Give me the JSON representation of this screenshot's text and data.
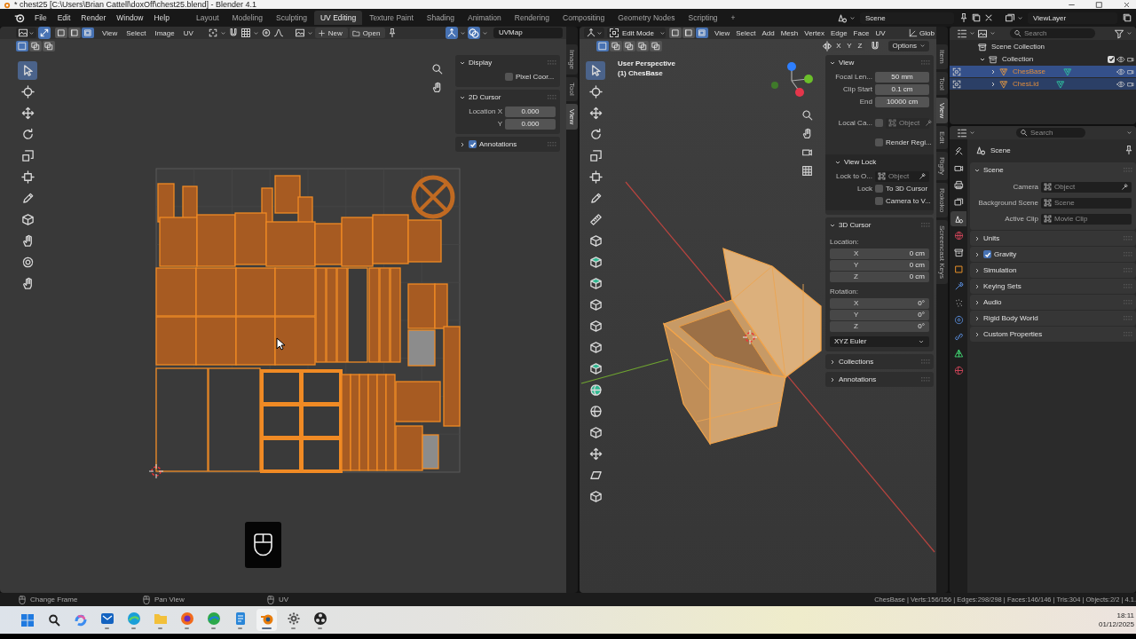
{
  "window": {
    "title": "* chest25 [C:\\Users\\Brian Cattell\\doxOff\\chest25.blend] - Blender 4.1"
  },
  "top_bar": {
    "menus": [
      "File",
      "Edit",
      "Render",
      "Window",
      "Help"
    ],
    "workspaces": [
      {
        "label": "Layout",
        "selected": false
      },
      {
        "label": "Modeling",
        "selected": false
      },
      {
        "label": "Sculpting",
        "selected": false
      },
      {
        "label": "UV Editing",
        "selected": true
      },
      {
        "label": "Texture Paint",
        "selected": false
      },
      {
        "label": "Shading",
        "selected": false
      },
      {
        "label": "Animation",
        "selected": false
      },
      {
        "label": "Rendering",
        "selected": false
      },
      {
        "label": "Compositing",
        "selected": false
      },
      {
        "label": "Geometry Nodes",
        "selected": false
      },
      {
        "label": "Scripting",
        "selected": false
      }
    ],
    "add_tab": "+",
    "scene": "Scene",
    "view_layer": "ViewLayer"
  },
  "uv_editor": {
    "header": {
      "uv_sync": true,
      "select_modes": [
        {
          "selected": false
        },
        {
          "selected": false
        },
        {
          "selected": true
        }
      ],
      "menus": [
        "View",
        "Select",
        "Image",
        "UV"
      ],
      "new_button": "New",
      "open_button": "Open",
      "toggles": [
        {
          "on": true
        },
        {
          "on": true
        }
      ],
      "uv_map": "UVMap"
    },
    "box_modes": [
      {
        "selected": true
      },
      {
        "selected": false
      },
      {
        "selected": false
      }
    ],
    "tools": [
      {
        "selected": true
      },
      {
        "selected": false
      },
      {
        "selected": false
      },
      {
        "selected": false
      },
      {
        "selected": false
      },
      {
        "selected": false
      },
      {
        "selected": false
      },
      {
        "selected": false
      },
      {
        "selected": false
      },
      {
        "selected": false
      },
      {
        "selected": false
      }
    ],
    "sidebar": [
      {
        "title": "Display",
        "expanded": true,
        "rows": [
          {
            "kind": "checkbox",
            "label": "Pixel Coor...",
            "checked": false
          }
        ]
      },
      {
        "title": "2D Cursor",
        "expanded": true,
        "rows": [
          {
            "kind": "number",
            "label": "Location X",
            "value": "0.000"
          },
          {
            "kind": "number",
            "label": "Y",
            "value": "0.000"
          }
        ]
      },
      {
        "title": "Annotations",
        "expanded": false,
        "checked": true
      }
    ],
    "tabs": [
      {
        "label": "Image",
        "selected": false
      },
      {
        "label": "Tool",
        "selected": false
      },
      {
        "label": "View",
        "selected": true
      }
    ]
  },
  "viewport": {
    "header": {
      "mode": "Edit Mode",
      "select_modes": [
        {
          "selected": false
        },
        {
          "selected": false
        },
        {
          "selected": true
        }
      ],
      "menus": [
        "View",
        "Select",
        "Add",
        "Mesh",
        "Vertex",
        "Edge",
        "Face",
        "UV"
      ],
      "orientation": "Glob",
      "axes": [
        {
          "label": "X",
          "on": false
        },
        {
          "label": "Y",
          "on": false
        },
        {
          "label": "Z",
          "on": false
        }
      ],
      "options": "Options"
    },
    "box_modes": [
      {
        "selected": true
      },
      {
        "selected": false
      },
      {
        "selected": false
      },
      {
        "selected": false
      },
      {
        "selected": false
      }
    ],
    "view_name": "User Perspective",
    "object_name": "(1) ChesBase",
    "tools": [
      {
        "selected": true
      },
      {
        "selected": false
      },
      {
        "selected": false
      },
      {
        "selected": false
      },
      {
        "selected": false
      },
      {
        "selected": false
      },
      {
        "selected": false
      },
      {
        "selected": false
      },
      {
        "selected": false
      },
      {
        "selected": false
      },
      {
        "selected": false
      },
      {
        "selected": false
      },
      {
        "selected": false
      },
      {
        "selected": false
      },
      {
        "selected": false
      },
      {
        "selected": false
      },
      {
        "selected": false
      },
      {
        "selected": false
      },
      {
        "selected": false
      },
      {
        "selected": false
      },
      {
        "selected": false
      }
    ],
    "sidebar": [
      {
        "title": "View",
        "expanded": true,
        "rows": [
          {
            "kind": "number",
            "label": "Focal Len...",
            "value": "50 mm"
          },
          {
            "kind": "number",
            "label": "Clip Start",
            "value": "0.1 cm"
          },
          {
            "kind": "number",
            "label": "End",
            "value": "10000 cm"
          },
          {
            "kind": "check_object",
            "label": "Local Ca...",
            "checked": false,
            "placeholder": "Object",
            "disabled": true,
            "eyedropper": true
          },
          {
            "kind": "checkbox",
            "label": "Render Regi...",
            "checked": false
          },
          {
            "kind": "subpanel",
            "title": "View Lock",
            "expanded": true,
            "rows": [
              {
                "kind": "object",
                "label": "Lock to O...",
                "placeholder": "Object",
                "disabled": false,
                "eyedropper": true
              },
              {
                "kind": "checkbox",
                "prefix": "Lock",
                "label": "To 3D Cursor",
                "checked": false
              },
              {
                "kind": "checkbox",
                "label": "Camera to V...",
                "checked": false
              }
            ]
          }
        ]
      },
      {
        "title": "3D Cursor",
        "expanded": true,
        "rows": [
          {
            "kind": "heading",
            "label": "Location:"
          },
          {
            "kind": "vector",
            "label": "X",
            "value": "0 cm"
          },
          {
            "kind": "vector",
            "label": "Y",
            "value": "0 cm"
          },
          {
            "kind": "vector",
            "label": "Z",
            "value": "0 cm"
          },
          {
            "kind": "heading",
            "label": "Rotation:"
          },
          {
            "kind": "vector",
            "label": "X",
            "value": "0°"
          },
          {
            "kind": "vector",
            "label": "Y",
            "value": "0°"
          },
          {
            "kind": "vector",
            "label": "Z",
            "value": "0°"
          },
          {
            "kind": "dropdown",
            "value": "XYZ Euler"
          }
        ]
      },
      {
        "title": "Collections",
        "expanded": false
      },
      {
        "title": "Annotations",
        "expanded": false
      }
    ],
    "tabs": [
      {
        "label": "Item",
        "selected": false
      },
      {
        "label": "Tool",
        "selected": false
      },
      {
        "label": "View",
        "selected": true
      },
      {
        "label": "Edit",
        "selected": false
      },
      {
        "label": "Rigify",
        "selected": false
      },
      {
        "label": "Rokoko",
        "selected": false
      },
      {
        "label": "Screencast Keys",
        "selected": false
      }
    ]
  },
  "outliner": {
    "search": {
      "placeholder": "Search"
    },
    "tree": [
      {
        "kind": "scene_collection",
        "label": "Scene Collection",
        "selected": false,
        "children": [
          {
            "kind": "collection",
            "label": "Collection",
            "expanded": true,
            "checked": true,
            "selected": false,
            "children": [
              {
                "kind": "object",
                "label": "ChesBase",
                "expanded": false,
                "selected": true,
                "active": true
              },
              {
                "kind": "object",
                "label": "ChesLid",
                "expanded": false,
                "selected": true,
                "active": false
              }
            ]
          }
        ]
      }
    ]
  },
  "properties": {
    "search": {
      "placeholder": "Search"
    },
    "tabs": [
      {
        "selected": false
      },
      {
        "selected": false
      },
      {
        "selected": false
      },
      {
        "selected": false
      },
      {
        "selected": true
      },
      {
        "selected": false
      },
      {
        "selected": false
      },
      {
        "selected": false
      },
      {
        "selected": false
      },
      {
        "selected": false
      },
      {
        "selected": false
      },
      {
        "selected": false
      },
      {
        "selected": false
      },
      {
        "selected": false
      }
    ],
    "context": "Scene",
    "panels": [
      {
        "title": "Scene",
        "expanded": true,
        "rows": [
          {
            "kind": "object",
            "label": "Camera",
            "placeholder": "Object",
            "disabled": false,
            "eyedropper": true
          },
          {
            "kind": "object",
            "label": "Background Scene",
            "placeholder": "Scene",
            "disabled": false,
            "eyedropper": false
          },
          {
            "kind": "object",
            "label": "Active Clip",
            "placeholder": "Movie Clip",
            "disabled": false,
            "eyedropper": false
          }
        ]
      },
      {
        "title": "Units",
        "expanded": false
      },
      {
        "title": "Gravity",
        "expanded": false,
        "checked": true
      },
      {
        "title": "Simulation",
        "expanded": false
      },
      {
        "title": "Keying Sets",
        "expanded": false
      },
      {
        "title": "Audio",
        "expanded": false
      },
      {
        "title": "Rigid Body World",
        "expanded": false
      },
      {
        "title": "Custom Properties",
        "expanded": false
      }
    ]
  },
  "status_bar": {
    "hints": [
      "Change Frame",
      "Pan View",
      "UV"
    ],
    "stats": "ChesBase | Verts:156/156 | Edges:298/298 | Faces:146/146 | Tris:304 | Objects:2/2 | 4.1."
  },
  "taskbar": {
    "apps": [
      {
        "running": false,
        "selected": false
      },
      {
        "running": false,
        "selected": false
      },
      {
        "running": false,
        "selected": false
      },
      {
        "running": true,
        "selected": false
      },
      {
        "running": true,
        "selected": false
      },
      {
        "running": true,
        "selected": false
      },
      {
        "running": true,
        "selected": false
      },
      {
        "running": true,
        "selected": false
      },
      {
        "running": true,
        "selected": false
      },
      {
        "running": true,
        "selected": true
      },
      {
        "running": true,
        "selected": false
      },
      {
        "running": true,
        "selected": false
      }
    ],
    "time": "18:11",
    "date": "01/12/2025"
  }
}
